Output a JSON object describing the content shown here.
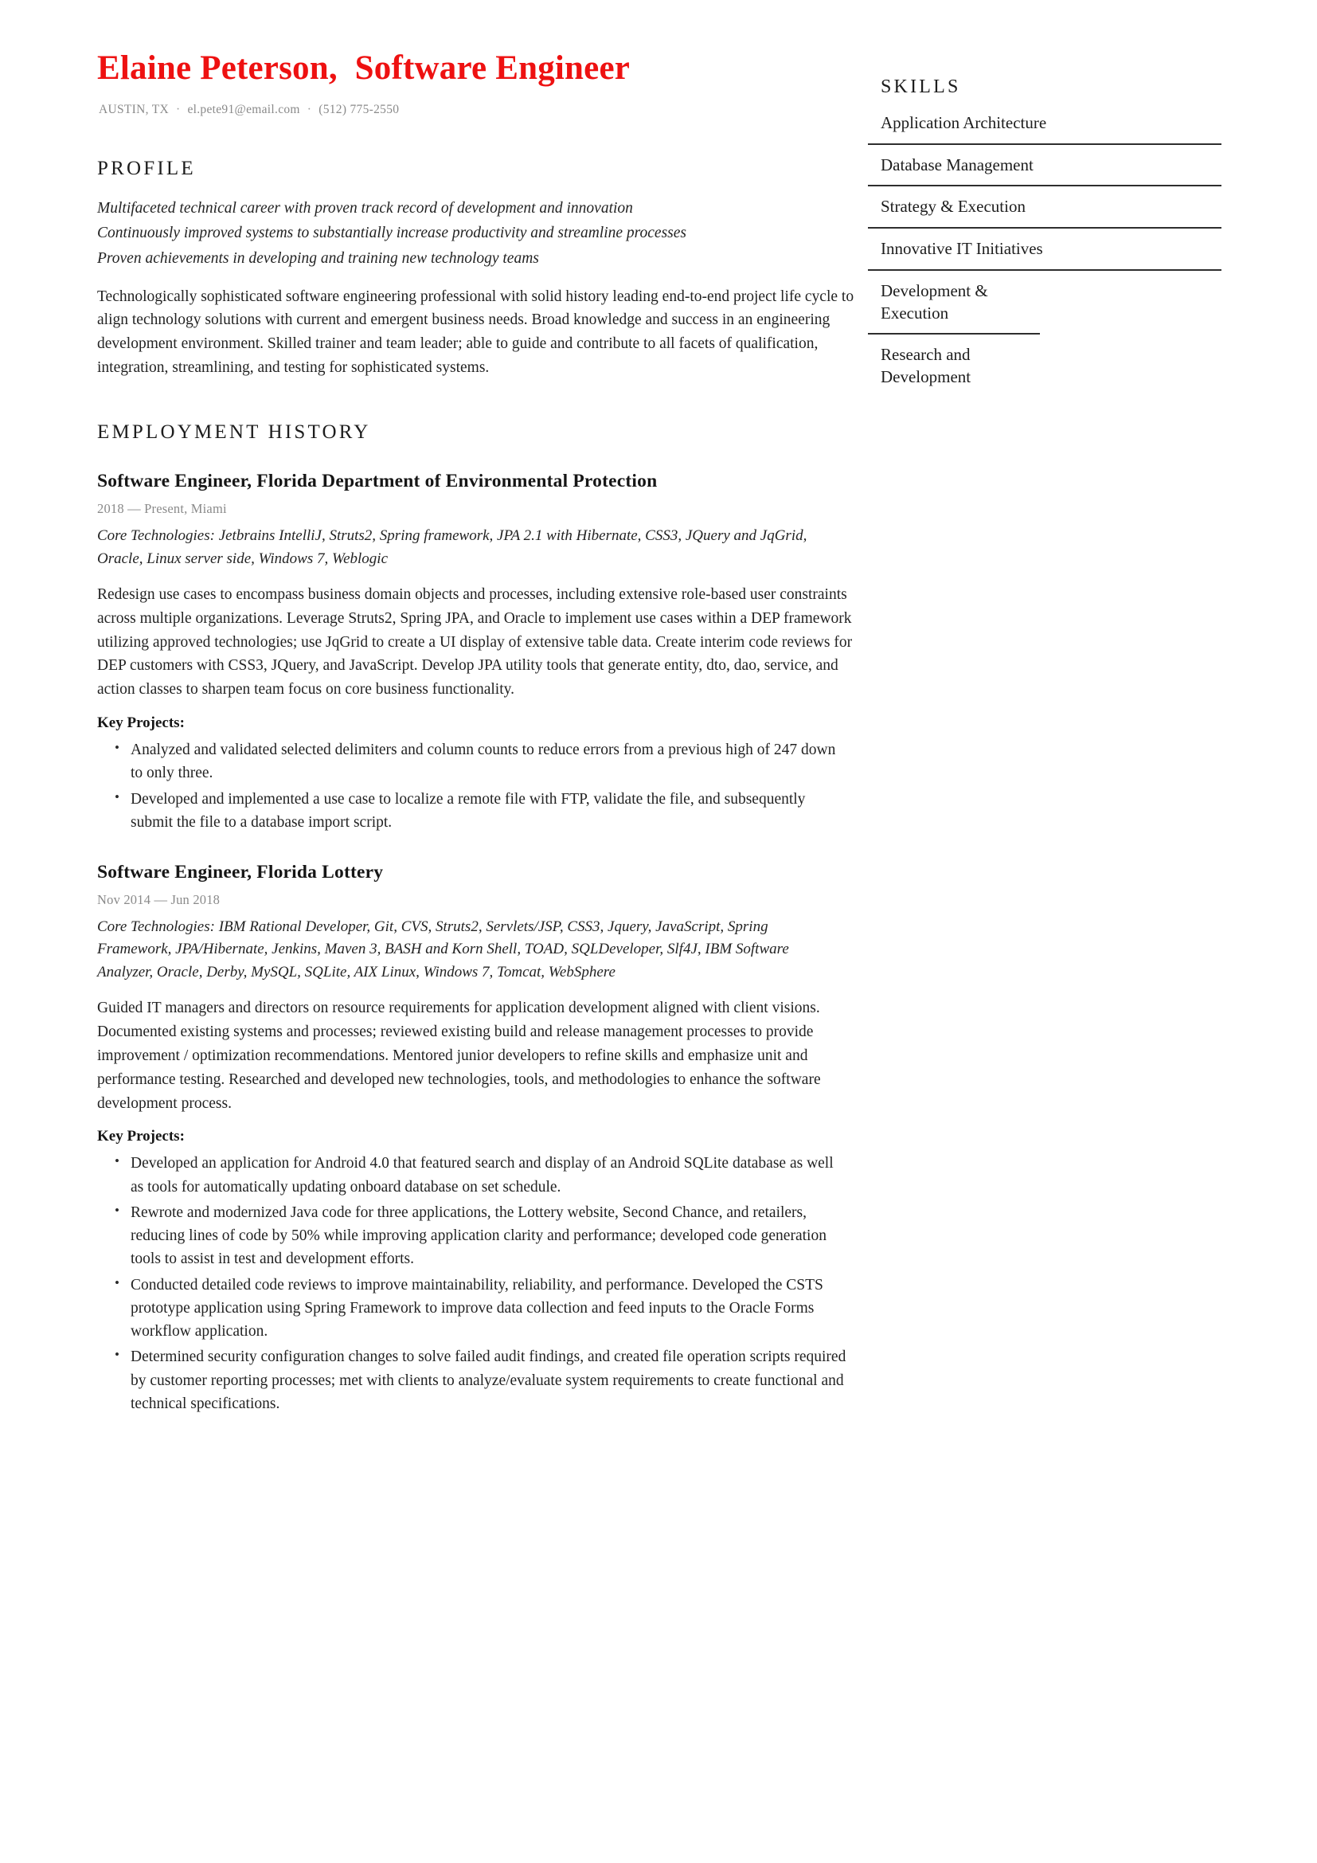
{
  "header": {
    "name_title": "Elaine Peterson,  Software Engineer",
    "location": "AUSTIN, TX",
    "email": "el.pete91@email.com",
    "phone": "(512) 775-2550",
    "separator": "·",
    "accent_color": "#ee1111"
  },
  "profile": {
    "heading": "PROFILE",
    "taglines": [
      "Multifaceted technical career with proven track record of development and innovation",
      "Continuously improved systems to substantially increase productivity and streamline processes",
      "Proven achievements in developing and training new technology teams"
    ],
    "summary": "Technologically sophisticated software engineering professional with solid history leading end-to-end project life cycle to align technology solutions with current and emergent business needs. Broad knowledge and success in an engineering development environment. Skilled trainer and team leader; able to guide and contribute to all facets of qualification, integration, streamlining, and testing for sophisticated systems."
  },
  "employment": {
    "heading": "EMPLOYMENT HISTORY",
    "key_projects_label": "Key Projects:",
    "jobs": [
      {
        "title": "Software Engineer, Florida Department of Environmental Protection",
        "meta": "2018 — Present, Miami",
        "technologies": "Core Technologies: Jetbrains IntelliJ, Struts2, Spring framework, JPA 2.1 with Hibernate, CSS3, JQuery and JqGrid, Oracle, Linux server side, Windows 7, Weblogic",
        "description": "Redesign use cases to encompass business domain objects and processes, including extensive role-based user constraints across multiple organizations. Leverage Struts2, Spring JPA, and Oracle to implement use cases within a DEP framework utilizing approved technologies; use JqGrid to create a UI display of extensive table data. Create interim code reviews for DEP customers with CSS3, JQuery, and JavaScript. Develop JPA utility tools that generate entity, dto, dao, service, and action classes to sharpen team focus on core business functionality.",
        "bullets": [
          "Analyzed and validated selected delimiters and column counts to reduce errors from a previous high of 247 down to only three.",
          "Developed and implemented a use case to localize a remote file with FTP, validate the file, and subsequently submit the file to a database import script."
        ]
      },
      {
        "title": "Software Engineer, Florida Lottery",
        "meta": "Nov 2014 — Jun 2018",
        "technologies": "Core Technologies: IBM Rational Developer, Git, CVS, Struts2, Servlets/JSP, CSS3, Jquery, JavaScript, Spring Framework, JPA/Hibernate, Jenkins, Maven 3, BASH and Korn Shell, TOAD, SQLDeveloper, Slf4J, IBM Software Analyzer, Oracle, Derby, MySQL, SQLite, AIX Linux, Windows 7, Tomcat, WebSphere",
        "description": "Guided IT managers and directors on resource requirements for application development aligned with client visions. Documented existing systems and processes; reviewed existing build and release management processes to provide improvement / optimization recommendations. Mentored junior developers to refine skills and emphasize unit and performance testing. Researched and developed new technologies, tools, and methodologies to enhance the software development process.",
        "bullets": [
          "Developed an application for  Android 4.0 that featured search and display of an Android SQLite database as well as tools for automatically updating onboard database on set schedule.",
          "Rewrote and modernized Java code for three applications, the Lottery website, Second Chance, and retailers, reducing lines of code by 50% while improving application clarity and performance; developed code generation tools to assist in test and development efforts.",
          "Conducted detailed code reviews to improve maintainability, reliability, and performance. Developed the CSTS prototype application using Spring Framework to improve data collection and feed inputs to the Oracle Forms workflow application.",
          "Determined security configuration changes to solve failed audit findings, and created file operation scripts required by customer reporting processes; met with clients to analyze/evaluate system requirements to create functional and technical specifications."
        ]
      }
    ]
  },
  "skills": {
    "heading": "SKILLS",
    "items": [
      "Application Architecture",
      "Database Management",
      "Strategy & Execution",
      "Innovative IT Initiatives",
      "Development & Execution",
      "Research and Development"
    ]
  }
}
